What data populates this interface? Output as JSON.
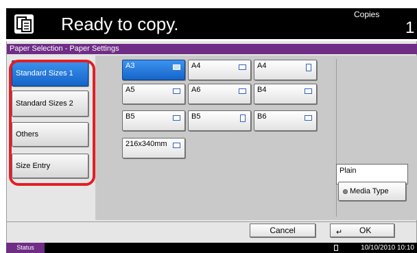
{
  "header": {
    "title": "Ready to copy.",
    "copies_label": "Copies",
    "copies_value": "1",
    "app_icon": "copy-document-icon"
  },
  "panel": {
    "title": "Paper Selection - Paper Settings"
  },
  "categories": [
    {
      "label": "Standard Sizes 1",
      "selected": true
    },
    {
      "label": "Standard Sizes 2",
      "selected": false
    },
    {
      "label": "Others",
      "selected": false
    },
    {
      "label": "Size Entry",
      "selected": false
    }
  ],
  "sizes": [
    {
      "label": "A3",
      "orientation": "landscape",
      "selected": true
    },
    {
      "label": "A4",
      "orientation": "landscape",
      "selected": false
    },
    {
      "label": "A4",
      "orientation": "portrait",
      "selected": false
    },
    {
      "label": "A5",
      "orientation": "landscape",
      "selected": false
    },
    {
      "label": "A6",
      "orientation": "landscape",
      "selected": false
    },
    {
      "label": "B4",
      "orientation": "landscape",
      "selected": false
    },
    {
      "label": "B5",
      "orientation": "landscape",
      "selected": false
    },
    {
      "label": "B5",
      "orientation": "portrait",
      "selected": false
    },
    {
      "label": "B6",
      "orientation": "landscape",
      "selected": false
    },
    {
      "label": "216x340mm",
      "orientation": "landscape",
      "selected": false
    }
  ],
  "media": {
    "current": "Plain",
    "button_label": "Media Type"
  },
  "actions": {
    "cancel_label": "Cancel",
    "ok_label": "OK"
  },
  "status": {
    "button_label": "Status",
    "datetime": "10/10/2010  10:10"
  },
  "colors": {
    "accent": "#6f2d86",
    "selected": "#1f6fd6",
    "highlight": "#e31e24"
  }
}
